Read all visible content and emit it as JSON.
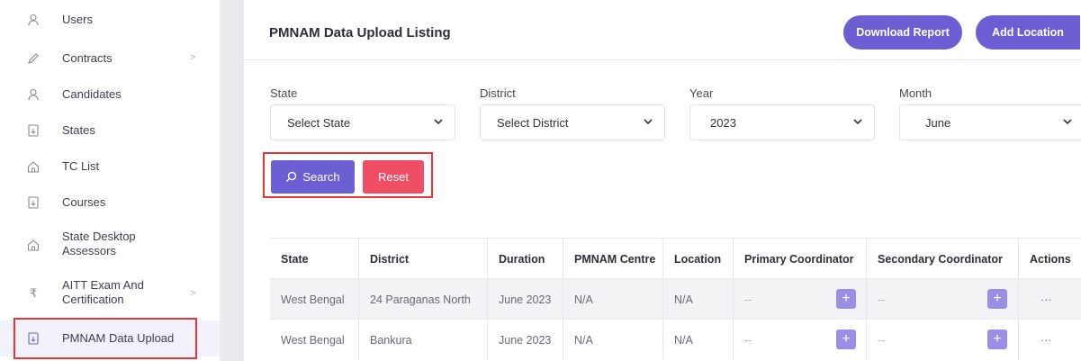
{
  "sidebar": {
    "items": [
      {
        "label": "Users",
        "icon": "user-icon"
      },
      {
        "label": "Contracts",
        "icon": "pen-icon",
        "chevron": ">"
      },
      {
        "label": "Candidates",
        "icon": "user-icon"
      },
      {
        "label": "States",
        "icon": "document-icon"
      },
      {
        "label": "TC List",
        "icon": "home-icon"
      },
      {
        "label": "Courses",
        "icon": "document-icon"
      },
      {
        "label": "State Desktop Assessors",
        "icon": "home-icon"
      },
      {
        "label": "AITT Exam And Certification",
        "icon": "rupee-icon",
        "chevron": ">"
      },
      {
        "label": "PMNAM Data Upload",
        "icon": "document-icon"
      }
    ]
  },
  "header": {
    "title": "PMNAM Data Upload Listing",
    "download_label": "Download Report",
    "add_label": "Add Location"
  },
  "filters": {
    "state": {
      "label": "State",
      "value": "Select State"
    },
    "district": {
      "label": "District",
      "value": "Select District"
    },
    "year": {
      "label": "Year",
      "value": "2023"
    },
    "month": {
      "label": "Month",
      "value": "June"
    }
  },
  "actions": {
    "search_label": "Search",
    "reset_label": "Reset"
  },
  "table": {
    "headers": [
      "State",
      "District",
      "Duration",
      "PMNAM Centre",
      "Location",
      "Primary Coordinator",
      "Secondary Coordinator",
      "Actions"
    ],
    "rows": [
      {
        "state": "West Bengal",
        "district": "24 Paraganas North",
        "duration": "June 2023",
        "centre": "N/A",
        "location": "N/A",
        "primary": "--",
        "secondary": "--",
        "actions": "···"
      },
      {
        "state": "West Bengal",
        "district": "Bankura",
        "duration": "June 2023",
        "centre": "N/A",
        "location": "N/A",
        "primary": "--",
        "secondary": "--",
        "actions": "···"
      }
    ]
  },
  "colors": {
    "accent": "#6c5fd3",
    "reset": "#f04e65",
    "highlight": "#e8333a"
  }
}
